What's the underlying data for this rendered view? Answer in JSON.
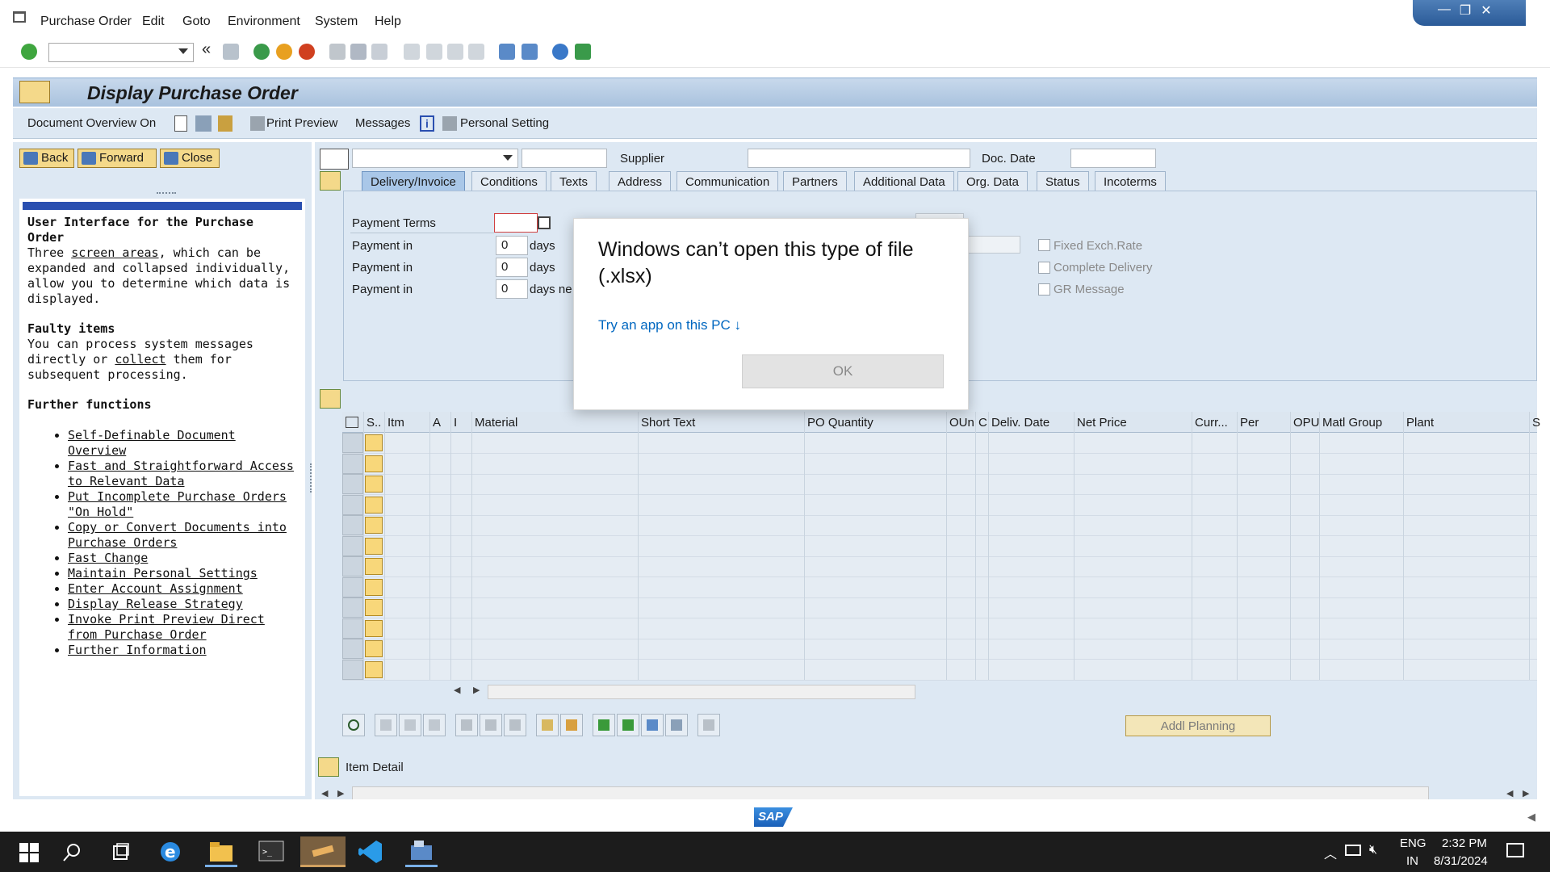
{
  "menu": {
    "items": [
      "Purchase Order",
      "Edit",
      "Goto",
      "Environment",
      "System",
      "Help"
    ]
  },
  "window_controls": {
    "minimize": "—",
    "restore": "❐",
    "close": "✕"
  },
  "toolbar": {
    "command_value": "",
    "history_glyph": "«"
  },
  "title": "Display Purchase Order",
  "app_toolbar": {
    "doc_overview": "Document Overview On",
    "print_preview": "Print Preview",
    "messages": "Messages",
    "personal_setting": "Personal Setting"
  },
  "nav": {
    "back": "Back",
    "forward": "Forward",
    "close": "Close"
  },
  "help": {
    "heading1": "User Interface for the Purchase Order",
    "para1_prefix": "Three ",
    "para1_link": "screen areas",
    "para1_suffix": ", which can be expanded and collapsed individually, allow you to determine which data is displayed.",
    "heading2": "Faulty items",
    "para2_prefix": "You can process system messages directly or ",
    "para2_link": "collect",
    "para2_suffix": " them for subsequent processing.",
    "heading3": "Further functions",
    "links": [
      "Self-Definable Document Overview",
      "Fast and Straightforward Access to Relevant Data",
      "Put Incomplete Purchase Orders \"On Hold\"",
      "Copy or Convert Documents into Purchase Orders",
      "Fast Change",
      "Maintain Personal Settings",
      "Enter Account Assignment",
      "Display Release Strategy",
      "Invoke Print Preview Direct from Purchase Order",
      "Further Information"
    ]
  },
  "header": {
    "supplier_label": "Supplier",
    "doc_date_label": "Doc. Date"
  },
  "tabs": [
    "Delivery/Invoice",
    "Conditions",
    "Texts",
    "Address",
    "Communication",
    "Partners",
    "Additional Data",
    "Org. Data",
    "Status",
    "Incoterms"
  ],
  "delivery": {
    "payment_terms_label": "Payment Terms",
    "payment_in_label": "Payment in",
    "rows": [
      {
        "value": "0",
        "unit": "days"
      },
      {
        "value": "0",
        "unit": "days"
      },
      {
        "value": "0",
        "unit": "days ne"
      }
    ],
    "checkboxes": [
      "Fixed Exch.Rate",
      "Complete Delivery",
      "GR Message"
    ]
  },
  "table": {
    "columns": [
      "S..",
      "Itm",
      "A",
      "I",
      "Material",
      "Short Text",
      "PO Quantity",
      "OUn",
      "C",
      "Deliv. Date",
      "Net Price",
      "Curr...",
      "Per",
      "OPU",
      "Matl Group",
      "Plant",
      "S"
    ],
    "row_count": 12
  },
  "addl_planning": "Addl Planning",
  "item_detail": "Item Detail",
  "dialog": {
    "message": "Windows can’t open this type of file (.xlsx)",
    "link": "Try an app on this PC ↓",
    "ok": "OK"
  },
  "sap_logo": "SAP",
  "taskbar": {
    "lang_top": "ENG",
    "lang_bottom": "IN",
    "time": "2:32 PM",
    "date": "8/31/2024"
  }
}
